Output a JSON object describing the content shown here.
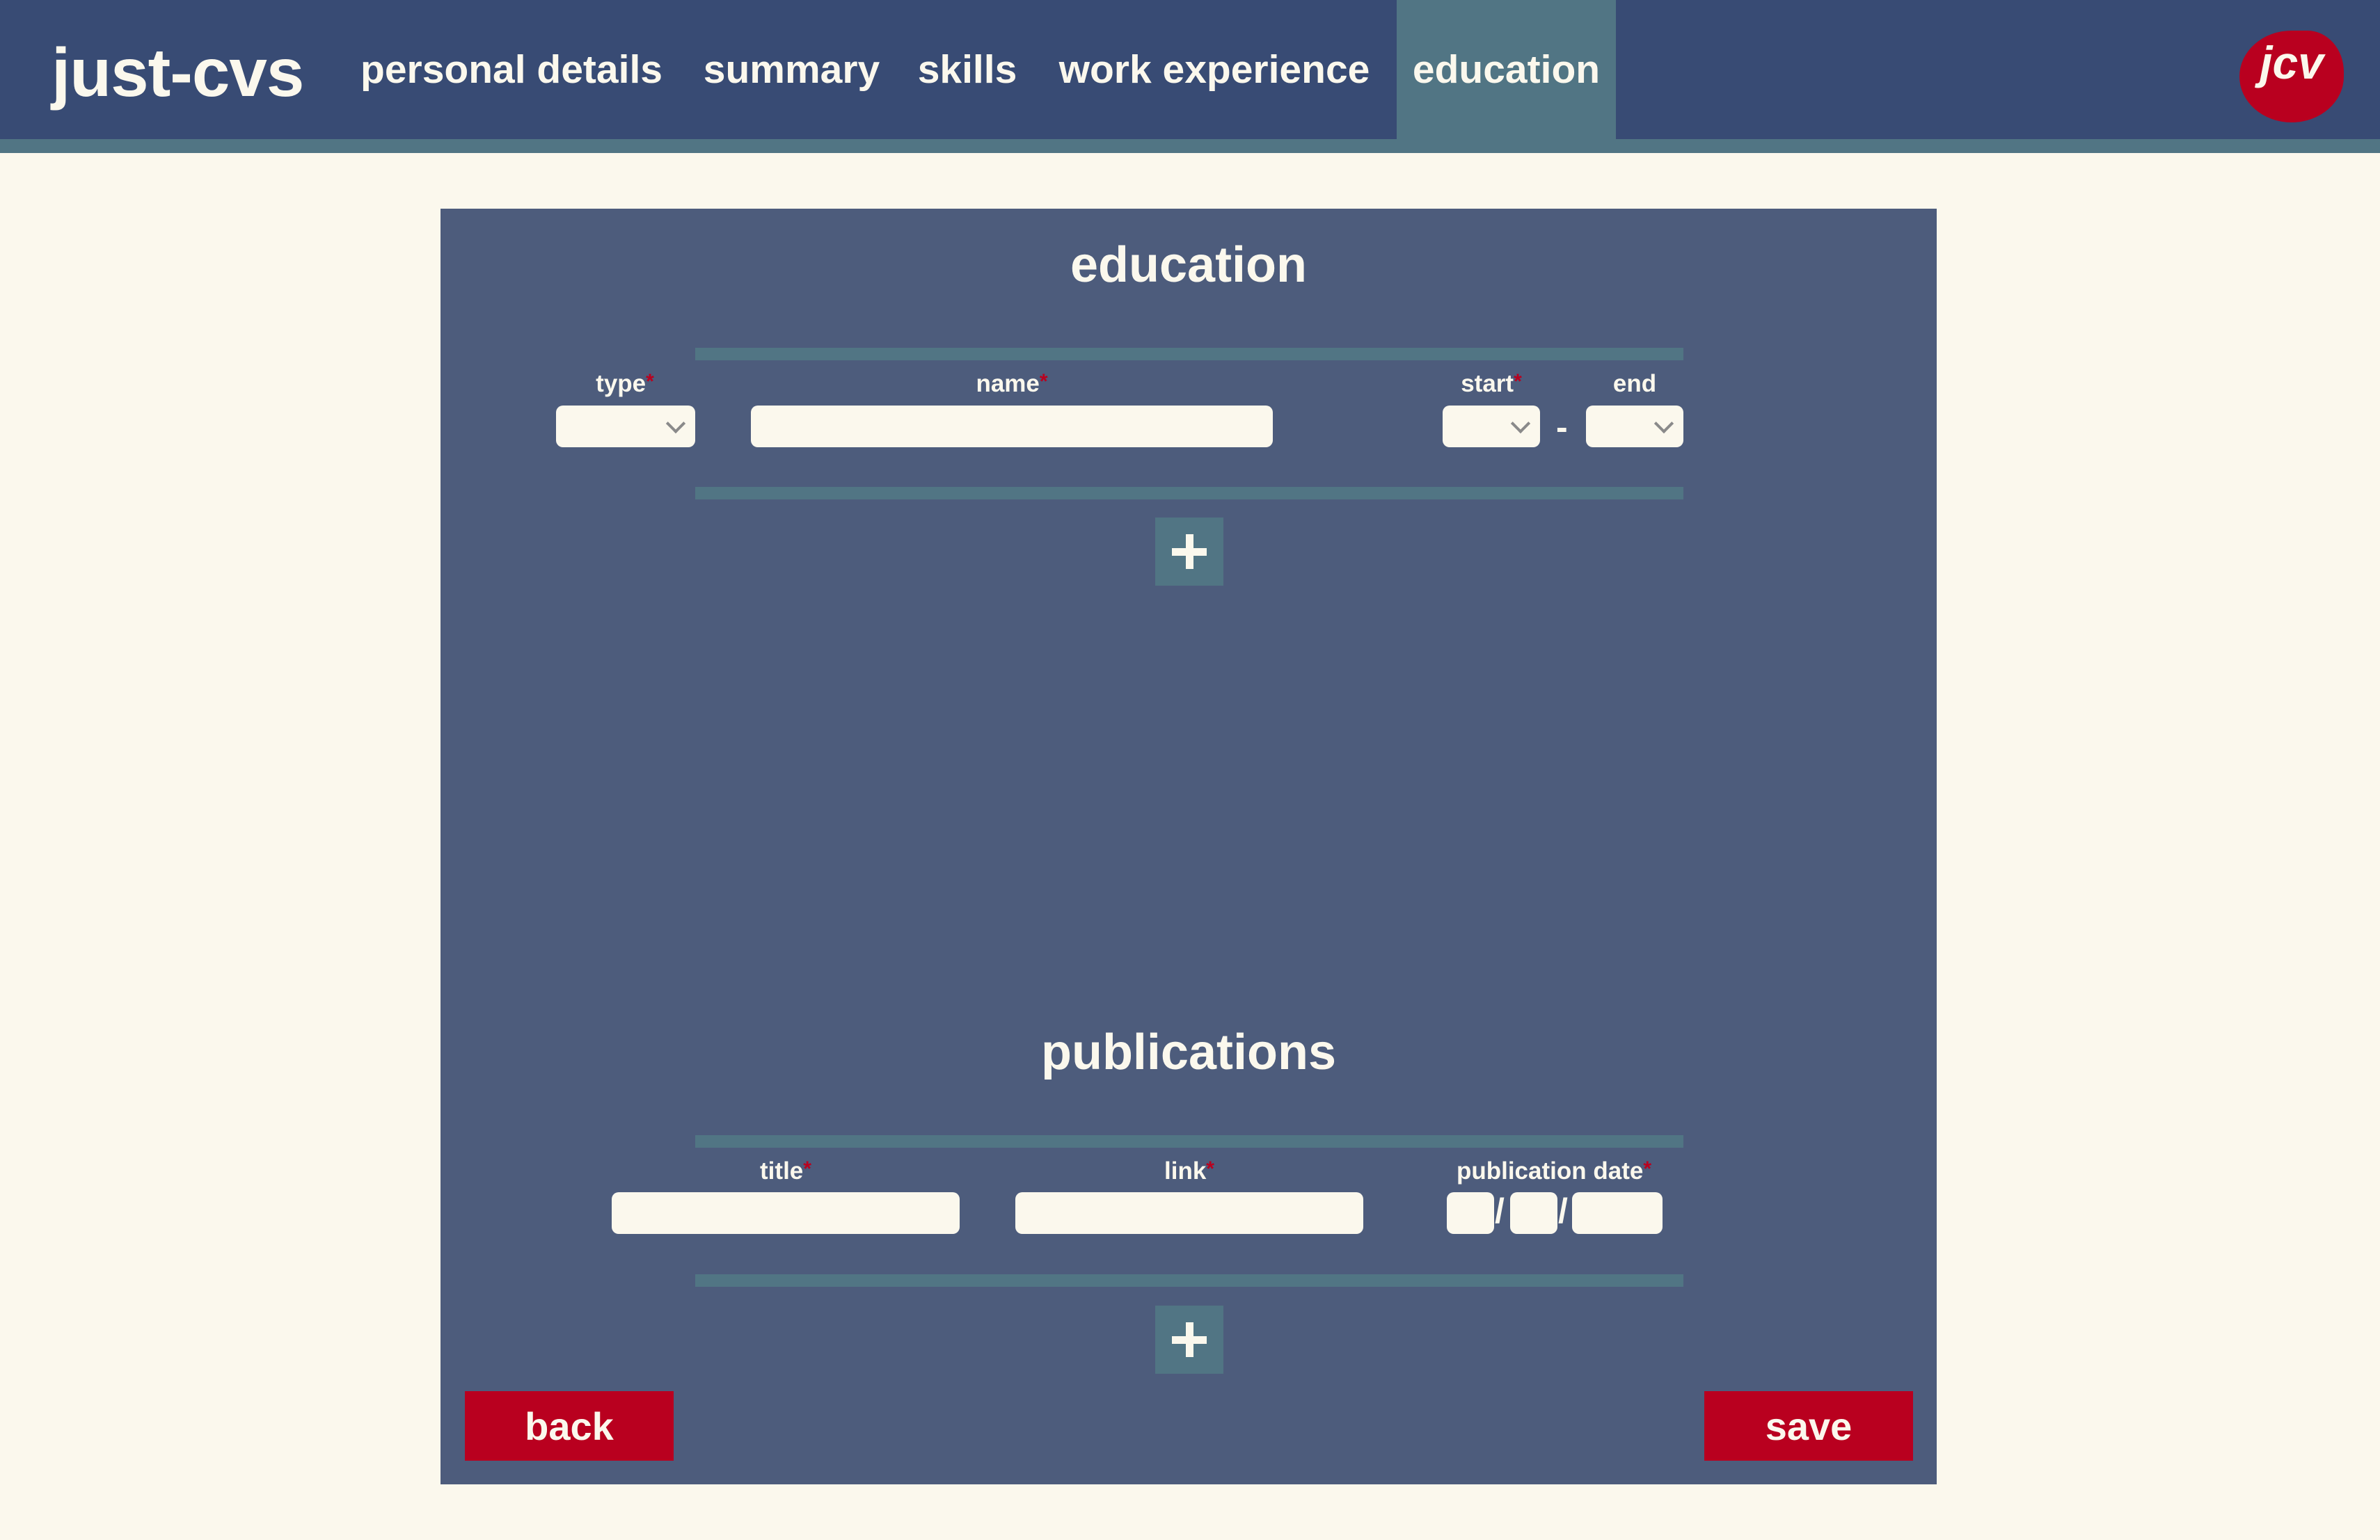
{
  "app": {
    "brand": "just-cvs",
    "logo_text": "jcv"
  },
  "nav": {
    "items": [
      {
        "label": "personal details"
      },
      {
        "label": "summary"
      },
      {
        "label": "skills"
      },
      {
        "label": "work experience"
      },
      {
        "label": "education",
        "active": true
      }
    ]
  },
  "education": {
    "title": "education",
    "fields": {
      "type": {
        "label": "type",
        "required": true,
        "value": ""
      },
      "name": {
        "label": "name",
        "required": true,
        "value": ""
      },
      "start": {
        "label": "start",
        "required": true,
        "value": ""
      },
      "end": {
        "label": "end",
        "required": false,
        "value": ""
      }
    },
    "range_separator": "-",
    "add_icon": "plus-icon"
  },
  "publications": {
    "title": "publications",
    "fields": {
      "title": {
        "label": "title",
        "required": true,
        "value": ""
      },
      "link": {
        "label": "link",
        "required": true,
        "value": ""
      },
      "publication_date": {
        "label": "publication date",
        "required": true,
        "value": ""
      }
    },
    "date_separator": "/",
    "add_icon": "plus-icon"
  },
  "actions": {
    "back_label": "back",
    "save_label": "save"
  },
  "required_marker": "*",
  "colors": {
    "header": "#384b74",
    "accent": "#517584",
    "panel": "#4d5c7c",
    "background": "#fbf8ed",
    "brand_red": "#b9001f"
  }
}
